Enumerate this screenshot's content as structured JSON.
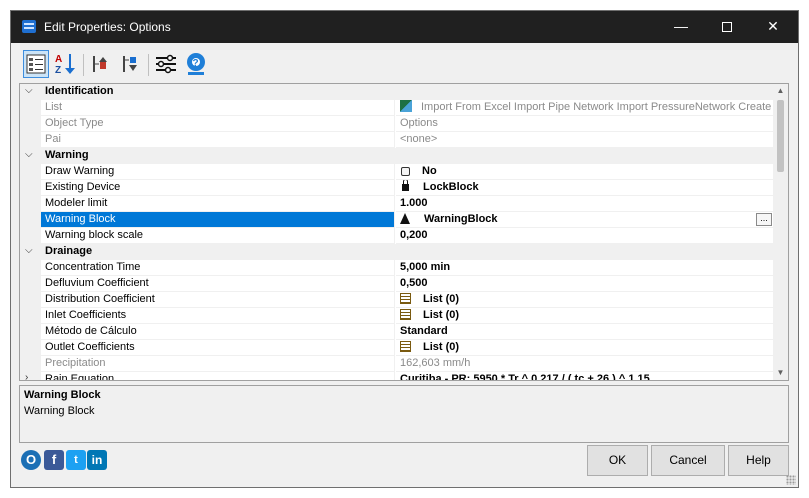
{
  "window": {
    "title": "Edit Properties: Options",
    "minimize": "—",
    "close": "✕"
  },
  "toolbar": {
    "buttons": [
      {
        "name": "categorized-view-icon"
      },
      {
        "name": "alphabetical-sort-icon"
      },
      {
        "name": "collapse-all-icon"
      },
      {
        "name": "expand-all-icon"
      },
      {
        "name": "settings-sliders-icon"
      },
      {
        "name": "help-lifebuoy-icon"
      }
    ]
  },
  "grid": {
    "rows": [
      {
        "type": "category",
        "label": "Identification"
      },
      {
        "type": "prop",
        "name": "List",
        "value": "Import From Excel Import Pipe Network Import PressureNetwork Create Ali",
        "readonly": true,
        "icon": "excel"
      },
      {
        "type": "prop",
        "name": "Object Type",
        "value": "Options",
        "readonly": true
      },
      {
        "type": "prop",
        "name": "Pai",
        "value": "<none>",
        "readonly": true
      },
      {
        "type": "category",
        "label": "Warning"
      },
      {
        "type": "prop",
        "name": "Draw Warning",
        "value": "No",
        "bold": true,
        "icon": "checkbox"
      },
      {
        "type": "prop",
        "name": "Existing Device",
        "value": "LockBlock",
        "bold": true,
        "icon": "lock"
      },
      {
        "type": "prop",
        "name": "Modeler limit",
        "value": "1.000",
        "bold": true
      },
      {
        "type": "prop",
        "name": "Warning Block",
        "value": "WarningBlock",
        "bold": true,
        "icon": "warning",
        "selected": true,
        "ellipsis": "..."
      },
      {
        "type": "prop",
        "name": "Warning block scale",
        "value": "0,200",
        "bold": true
      },
      {
        "type": "category",
        "label": "Drainage"
      },
      {
        "type": "prop",
        "name": "Concentration Time",
        "value": "5,000 min",
        "bold": true
      },
      {
        "type": "prop",
        "name": "Defluvium Coefficient",
        "value": "0,500",
        "bold": true
      },
      {
        "type": "prop",
        "name": "Distribution Coefficient",
        "value": "List (0)",
        "bold": true,
        "icon": "list"
      },
      {
        "type": "prop",
        "name": "Inlet Coefficients",
        "value": "List (0)",
        "bold": true,
        "icon": "list"
      },
      {
        "type": "prop",
        "name": "Método de Cálculo",
        "value": "Standard",
        "bold": true
      },
      {
        "type": "prop",
        "name": "Outlet Coefficients",
        "value": "List (0)",
        "bold": true,
        "icon": "list"
      },
      {
        "type": "prop",
        "name": "Precipitation",
        "value": "162,603 mm/h",
        "readonly": true
      },
      {
        "type": "prop",
        "name": "Rain Equation",
        "value": "Curitiba - PR: 5950 * Tr ^ 0,217 / ( tc + 26 ) ^ 1,15",
        "bold": true,
        "collapsed": true
      }
    ]
  },
  "description": {
    "title": "Warning Block",
    "text": "Warning Block"
  },
  "footer": {
    "social": [
      "O",
      "f",
      "t",
      "in"
    ],
    "ok": "OK",
    "cancel": "Cancel",
    "help": "Help"
  },
  "colors": {
    "titlebar": "#202020",
    "selection": "#0078d7"
  }
}
